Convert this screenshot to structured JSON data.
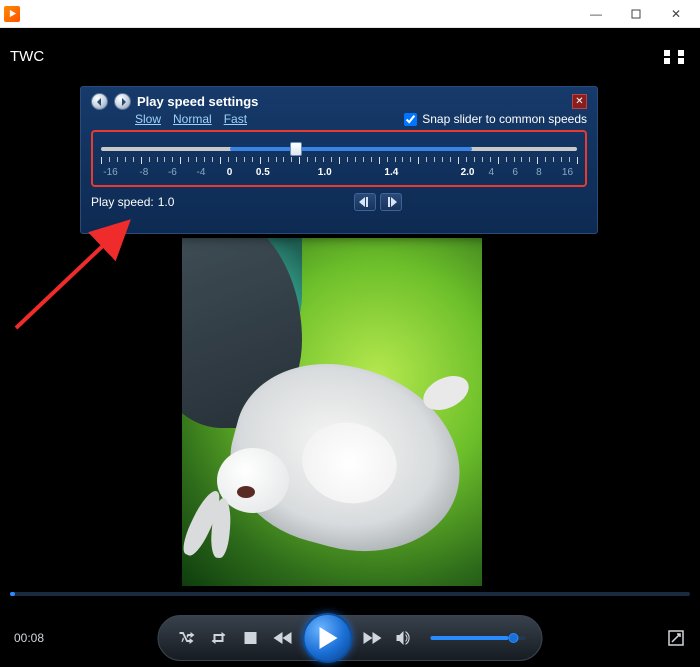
{
  "window": {
    "minimize": "—",
    "close": "✕"
  },
  "overlay_label": "TWC",
  "speed_panel": {
    "title": "Play speed settings",
    "links": {
      "slow": "Slow",
      "normal": "Normal",
      "fast": "Fast"
    },
    "snap_label": "Snap slider to common speeds",
    "snap_checked": true,
    "slider": {
      "active_start_pct": 27,
      "active_end_pct": 78,
      "thumb_pct": 41,
      "labels": [
        {
          "text": "-16",
          "pct": 2
        },
        {
          "text": "-8",
          "pct": 9
        },
        {
          "text": "-6",
          "pct": 15
        },
        {
          "text": "-4",
          "pct": 21
        },
        {
          "text": "0",
          "pct": 27,
          "hi": true
        },
        {
          "text": "0.5",
          "pct": 34,
          "hi": true
        },
        {
          "text": "1.0",
          "pct": 47,
          "hi": true
        },
        {
          "text": "1.4",
          "pct": 61,
          "hi": true
        },
        {
          "text": "2.0",
          "pct": 77,
          "hi": true
        },
        {
          "text": "4",
          "pct": 82
        },
        {
          "text": "6",
          "pct": 87
        },
        {
          "text": "8",
          "pct": 92
        },
        {
          "text": "16",
          "pct": 98
        }
      ]
    },
    "speed_label": "Play speed:",
    "speed_value": "1.0"
  },
  "playback": {
    "time_elapsed": "00:08",
    "seek_progress_pct": 0.8,
    "volume_pct": 82
  }
}
